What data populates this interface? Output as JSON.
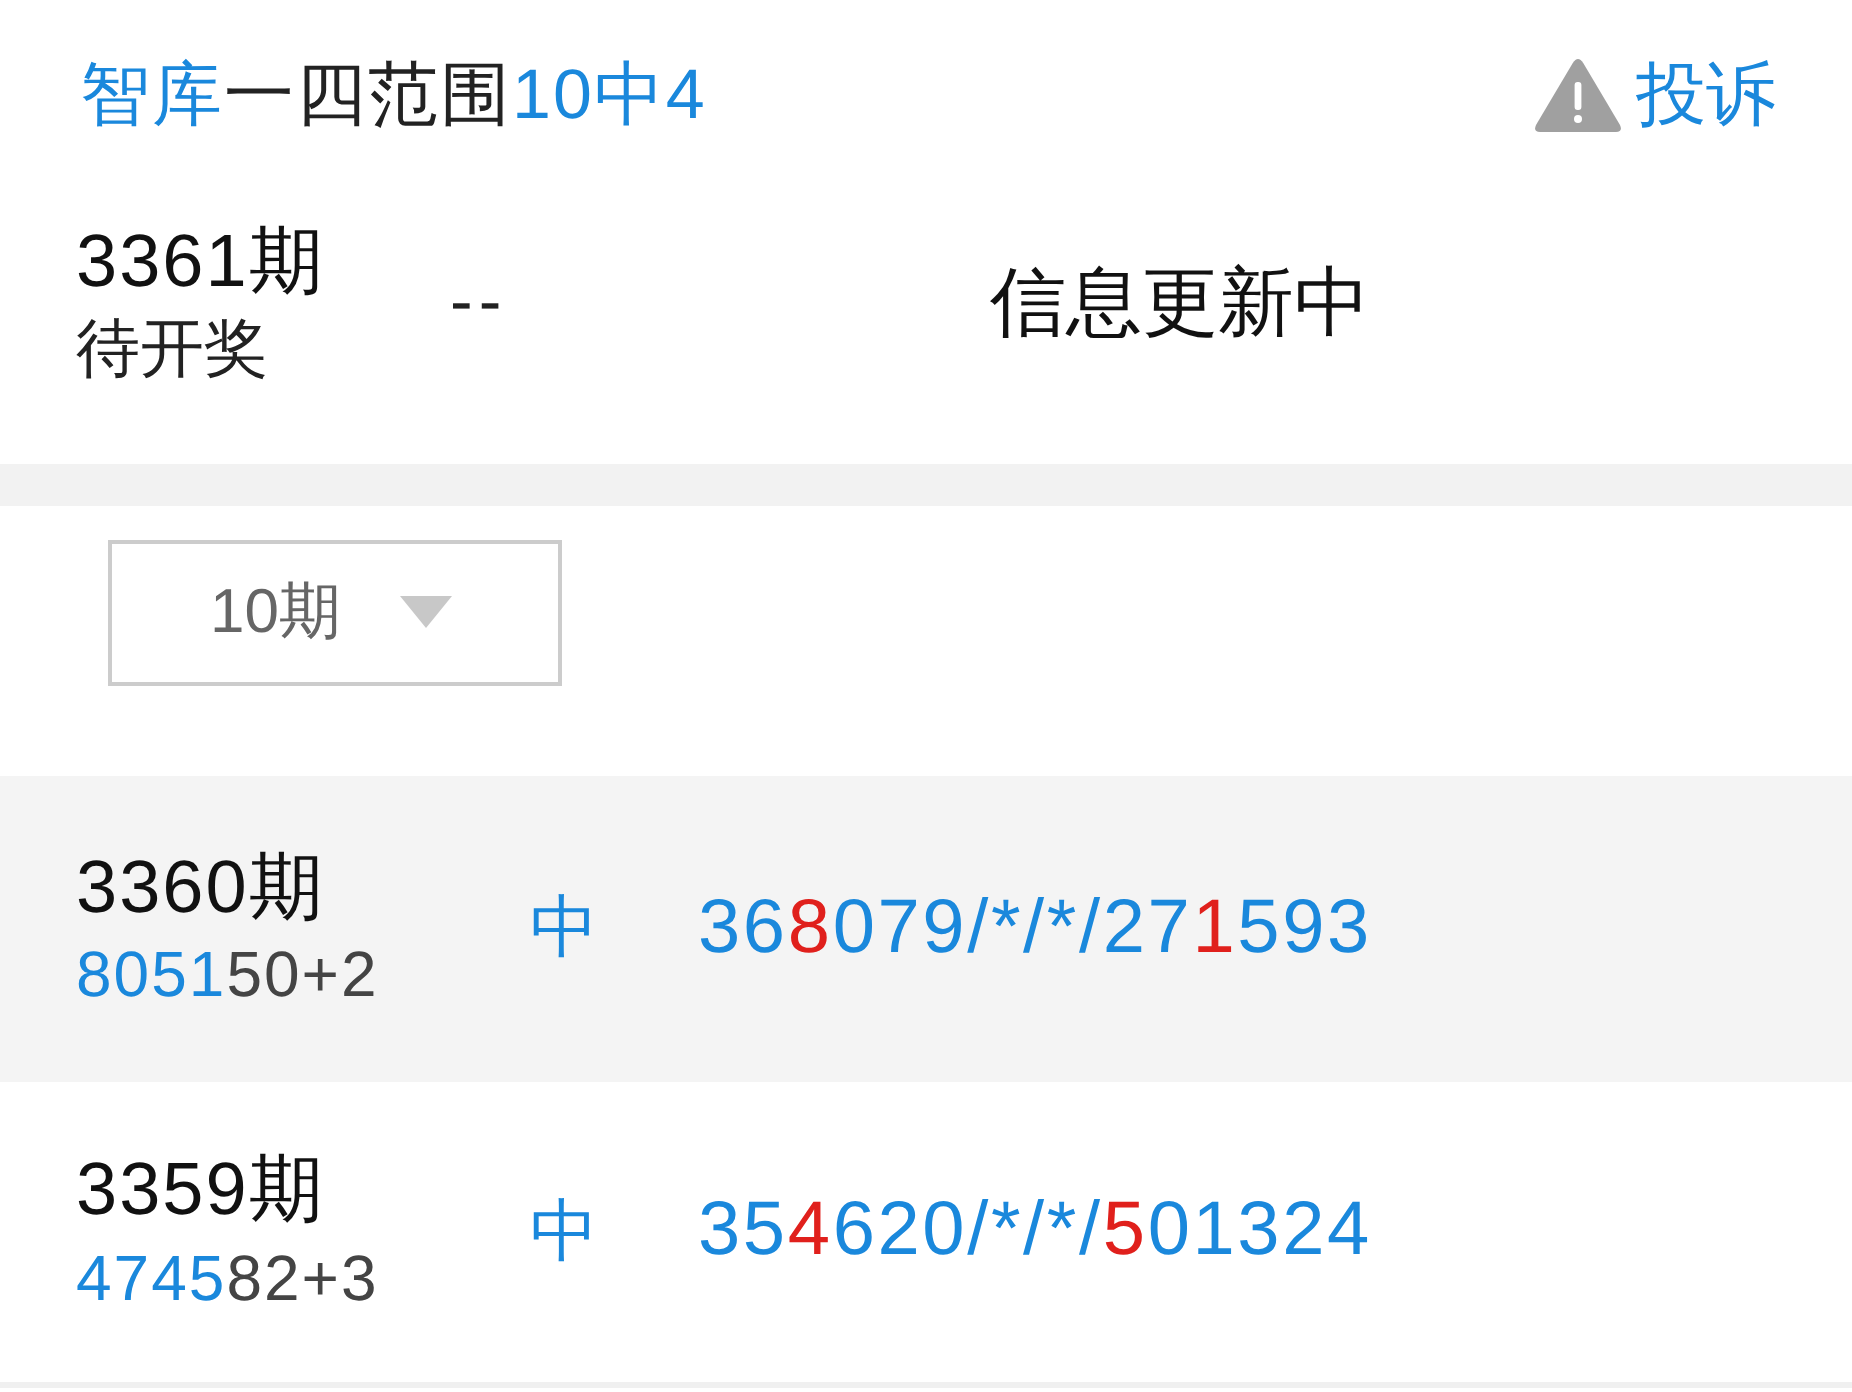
{
  "header": {
    "title": [
      {
        "text": "智库",
        "highlight": true
      },
      {
        "text": "一四范围",
        "highlight": false
      },
      {
        "text": "10中4",
        "highlight": true
      }
    ],
    "complaint": "投诉"
  },
  "current": {
    "issue": "3361期",
    "status": "待开奖",
    "result": "--",
    "message": "信息更新中"
  },
  "period_select": {
    "value": "10期"
  },
  "history": [
    {
      "issue": "3360期",
      "draw": [
        {
          "text": "8051",
          "highlight": true
        },
        {
          "text": "50+2",
          "highlight": false
        }
      ],
      "verdict": "中",
      "picks": [
        {
          "text": "36",
          "hit": false
        },
        {
          "text": "8",
          "hit": true
        },
        {
          "text": "079/*/*/27",
          "hit": false
        },
        {
          "text": "1",
          "hit": true
        },
        {
          "text": "593",
          "hit": false
        }
      ]
    },
    {
      "issue": "3359期",
      "draw": [
        {
          "text": "4745",
          "highlight": true
        },
        {
          "text": "82+3",
          "highlight": false
        }
      ],
      "verdict": "中",
      "picks": [
        {
          "text": "35",
          "hit": false
        },
        {
          "text": "4",
          "hit": true
        },
        {
          "text": "620/*/*/",
          "hit": false
        },
        {
          "text": "5",
          "hit": true
        },
        {
          "text": "01324",
          "hit": false
        }
      ]
    }
  ]
}
